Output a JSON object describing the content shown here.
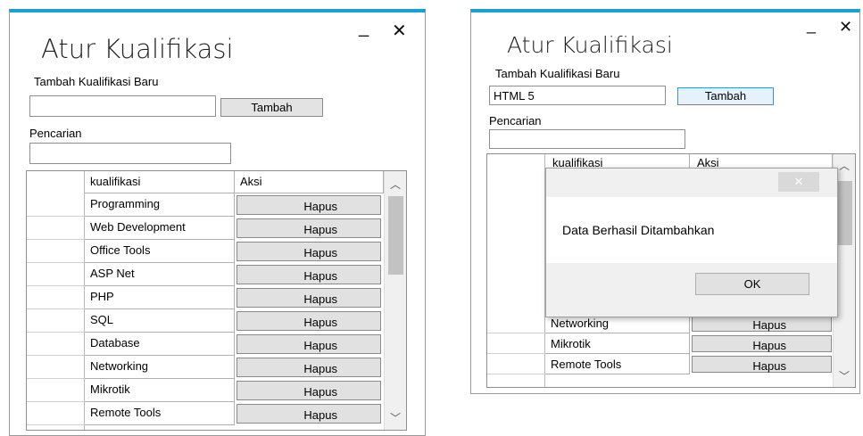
{
  "left": {
    "title": "Atur Kualifikasi",
    "minimize": "_",
    "close": "✕",
    "add_label": "Tambah Kualifikasi Baru",
    "add_input": "",
    "add_button": "Tambah",
    "search_label": "Pencarian",
    "search_input": "",
    "col_name": "kualifikasi",
    "col_action": "Aksi",
    "rows": [
      {
        "name": "Programming",
        "action": "Hapus"
      },
      {
        "name": "Web Development",
        "action": "Hapus"
      },
      {
        "name": "Office Tools",
        "action": "Hapus"
      },
      {
        "name": "ASP Net",
        "action": "Hapus"
      },
      {
        "name": "PHP",
        "action": "Hapus"
      },
      {
        "name": "SQL",
        "action": "Hapus"
      },
      {
        "name": "Database",
        "action": "Hapus"
      },
      {
        "name": "Networking",
        "action": "Hapus"
      },
      {
        "name": "Mikrotik",
        "action": "Hapus"
      },
      {
        "name": "Remote Tools",
        "action": "Hapus"
      }
    ]
  },
  "right": {
    "title": "Atur Kualifikasi",
    "minimize": "_",
    "close": "✕",
    "add_label": "Tambah Kualifikasi Baru",
    "add_input": "HTML 5",
    "add_button": "Tambah",
    "search_label": "Pencarian",
    "search_input": "",
    "col_name": "kualifikasi",
    "col_action": "Aksi",
    "rows": [
      {
        "name": "Networking",
        "action": "Hapus"
      },
      {
        "name": "Mikrotik",
        "action": "Hapus"
      },
      {
        "name": "Remote Tools",
        "action": "Hapus"
      }
    ],
    "dialog": {
      "close": "✕",
      "message": "Data Berhasil Ditambahkan",
      "ok": "OK"
    }
  },
  "colors": {
    "accent": "#17a1d6",
    "button_hover_border": "#3c8fd9"
  }
}
